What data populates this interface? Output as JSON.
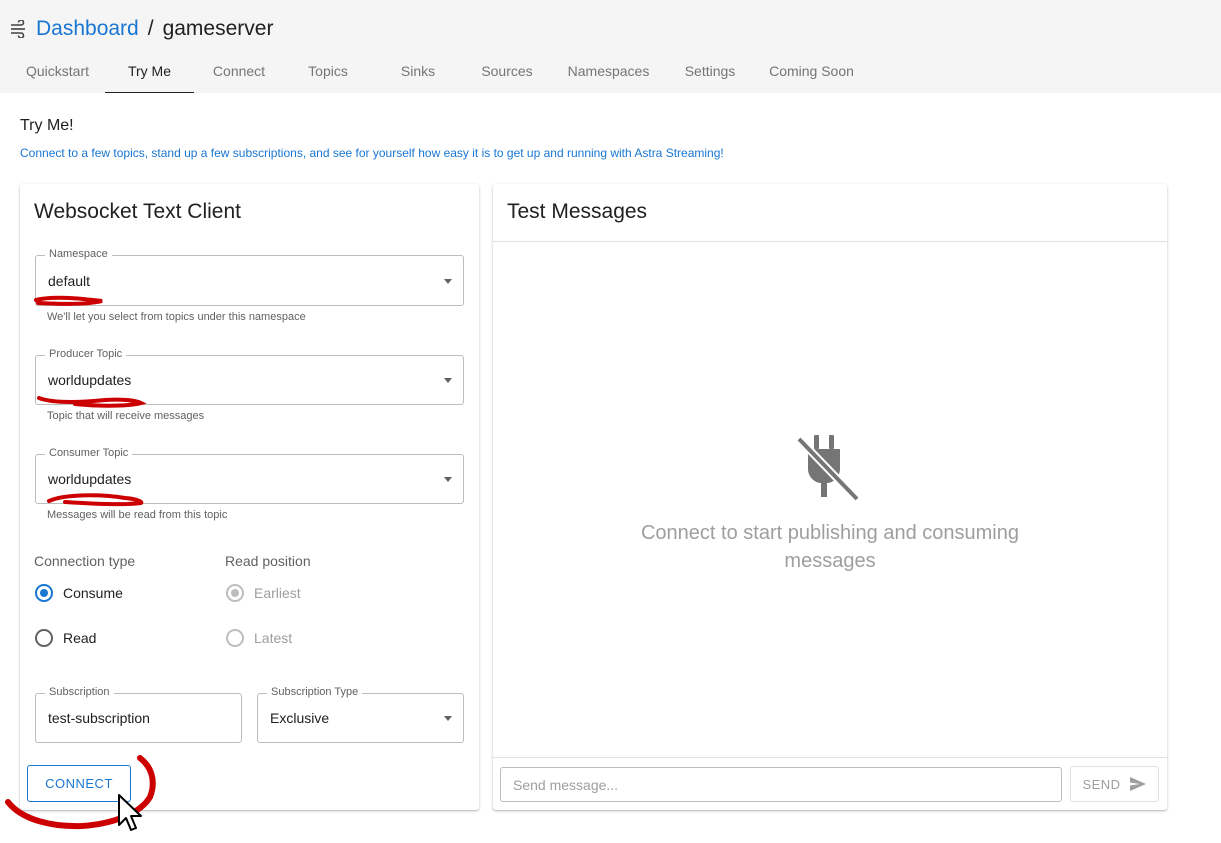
{
  "breadcrumb": {
    "parent": "Dashboard",
    "separator": "/",
    "current": "gameserver"
  },
  "tabs": [
    {
      "label": "Quickstart",
      "active": false
    },
    {
      "label": "Try Me",
      "active": true
    },
    {
      "label": "Connect",
      "active": false
    },
    {
      "label": "Topics",
      "active": false
    },
    {
      "label": "Sinks",
      "active": false
    },
    {
      "label": "Sources",
      "active": false
    },
    {
      "label": "Namespaces",
      "active": false
    },
    {
      "label": "Settings",
      "active": false
    },
    {
      "label": "Coming Soon",
      "active": false
    }
  ],
  "page": {
    "title": "Try Me!",
    "description": "Connect to a few topics, stand up a few subscriptions, and see for yourself how easy it is to get up and running with Astra Streaming!"
  },
  "client": {
    "title": "Websocket Text Client",
    "namespace": {
      "label": "Namespace",
      "value": "default",
      "helper": "We'll let you select from topics under this namespace"
    },
    "producer_topic": {
      "label": "Producer Topic",
      "value": "worldupdates",
      "helper": "Topic that will receive messages"
    },
    "consumer_topic": {
      "label": "Consumer Topic",
      "value": "worldupdates",
      "helper": "Messages will be read from this topic"
    },
    "connection_type": {
      "label": "Connection type",
      "options": [
        "Consume",
        "Read"
      ],
      "selected": "Consume"
    },
    "read_position": {
      "label": "Read position",
      "options": [
        "Earliest",
        "Latest"
      ],
      "selected": "Earliest",
      "disabled": true
    },
    "subscription": {
      "label": "Subscription",
      "value": "test-subscription"
    },
    "subscription_type": {
      "label": "Subscription Type",
      "value": "Exclusive"
    },
    "connect_label": "CONNECT"
  },
  "messages": {
    "title": "Test Messages",
    "empty_text": "Connect to start publishing and consuming messages",
    "input_placeholder": "Send message...",
    "send_label": "SEND"
  },
  "colors": {
    "accent": "#1976d2",
    "annotation": "#cc0000",
    "muted": "#9e9e9e"
  }
}
